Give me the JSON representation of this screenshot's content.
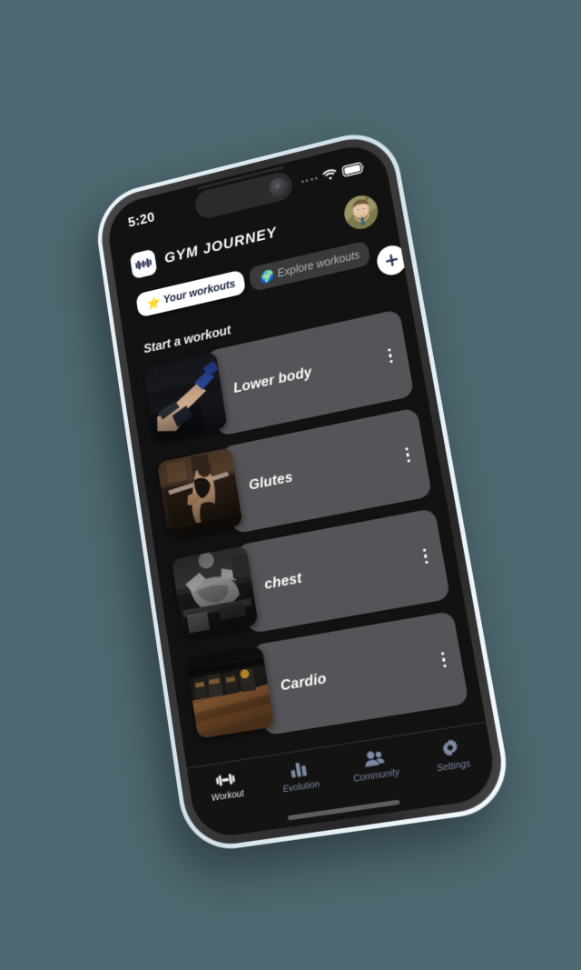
{
  "background_color": "#4d6870",
  "device": {
    "frame_color": "#e4eef3",
    "bezel_color": "#323234",
    "screen_bg": "#121212"
  },
  "status_bar": {
    "time": "5:20",
    "signal_dots": 4,
    "wifi_icon": "wifi-icon",
    "battery_icon": "battery-icon"
  },
  "header": {
    "logo_icon": "dumbbell-logo-icon",
    "title": "GYM JOURNEY",
    "avatar_label": "user-avatar"
  },
  "tabs": [
    {
      "id": "your-workouts",
      "label": "Your workouts",
      "emoji": "⭐",
      "active": true
    },
    {
      "id": "explore-workouts",
      "label": "Explore workouts",
      "emoji": "🌍",
      "active": false
    }
  ],
  "add_button": {
    "label": "+",
    "icon": "plus-icon",
    "color": "#1b2a4a"
  },
  "section": {
    "title": "Start a workout"
  },
  "workouts": [
    {
      "id": "lower-body",
      "name": "Lower body",
      "thumb": "leg-press-photo",
      "menu_icon": "more-vertical-icon"
    },
    {
      "id": "glutes",
      "name": "Glutes",
      "thumb": "squat-photo",
      "menu_icon": "more-vertical-icon"
    },
    {
      "id": "chest",
      "name": "chest",
      "thumb": "bench-press-photo",
      "menu_icon": "more-vertical-icon"
    },
    {
      "id": "cardio",
      "name": "Cardio",
      "thumb": "cardio-floor-photo",
      "menu_icon": "more-vertical-icon"
    }
  ],
  "bottom_nav": {
    "active_color": "#f0f0f0",
    "inactive_color": "#7d8aa3",
    "items": [
      {
        "id": "workout",
        "label": "Workout",
        "icon": "dumbbell-icon",
        "active": true
      },
      {
        "id": "evolution",
        "label": "Evolution",
        "icon": "bar-chart-icon",
        "active": false
      },
      {
        "id": "community",
        "label": "Community",
        "icon": "people-icon",
        "active": false
      },
      {
        "id": "settings",
        "label": "Settings",
        "icon": "gear-icon",
        "active": false
      }
    ]
  }
}
